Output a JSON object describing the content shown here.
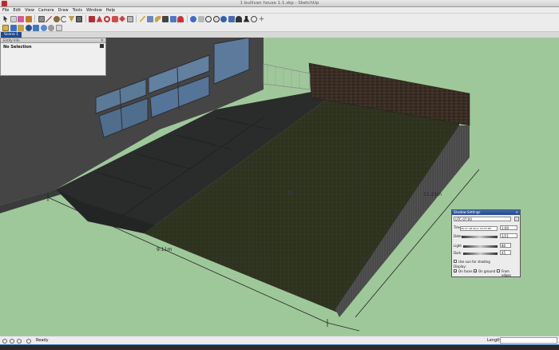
{
  "window": {
    "title": "1 bullivan house 1:1.skp - SketchUp"
  },
  "menu": [
    "File",
    "Edit",
    "View",
    "Camera",
    "Draw",
    "Tools",
    "Window",
    "Help"
  ],
  "scene_tab": "Scene 1",
  "entity_info": {
    "header": "Entity Info",
    "selection": "No Selection"
  },
  "dimensions": {
    "width": "9.11m",
    "length": "11.21m"
  },
  "shadow_settings": {
    "title": "Shadow Settings",
    "timezone": "UTC-07:00",
    "time_label": "Time",
    "time_value": "1:00",
    "time_strip": "06:37  AM  Noon  04:35 PM",
    "date_label": "Date",
    "date_value": "1/21",
    "light_label": "Light",
    "light_value": "80",
    "dark_label": "Dark",
    "dark_value": "45",
    "use_sun_label": "Use sun for shading",
    "display_label": "Display:",
    "on_faces": "On faces",
    "on_ground": "On ground",
    "from_edges": "From edges",
    "on_faces_checked": true,
    "on_ground_checked": true,
    "from_edges_checked": false
  },
  "status": {
    "ready": "Ready",
    "length_label": "Length"
  },
  "colors": {
    "sky": "#9fc89a",
    "grass": "#2f3420",
    "paving": "#2a2c2c",
    "fence": "#3a2e25",
    "selection": "#1e4b8f"
  }
}
